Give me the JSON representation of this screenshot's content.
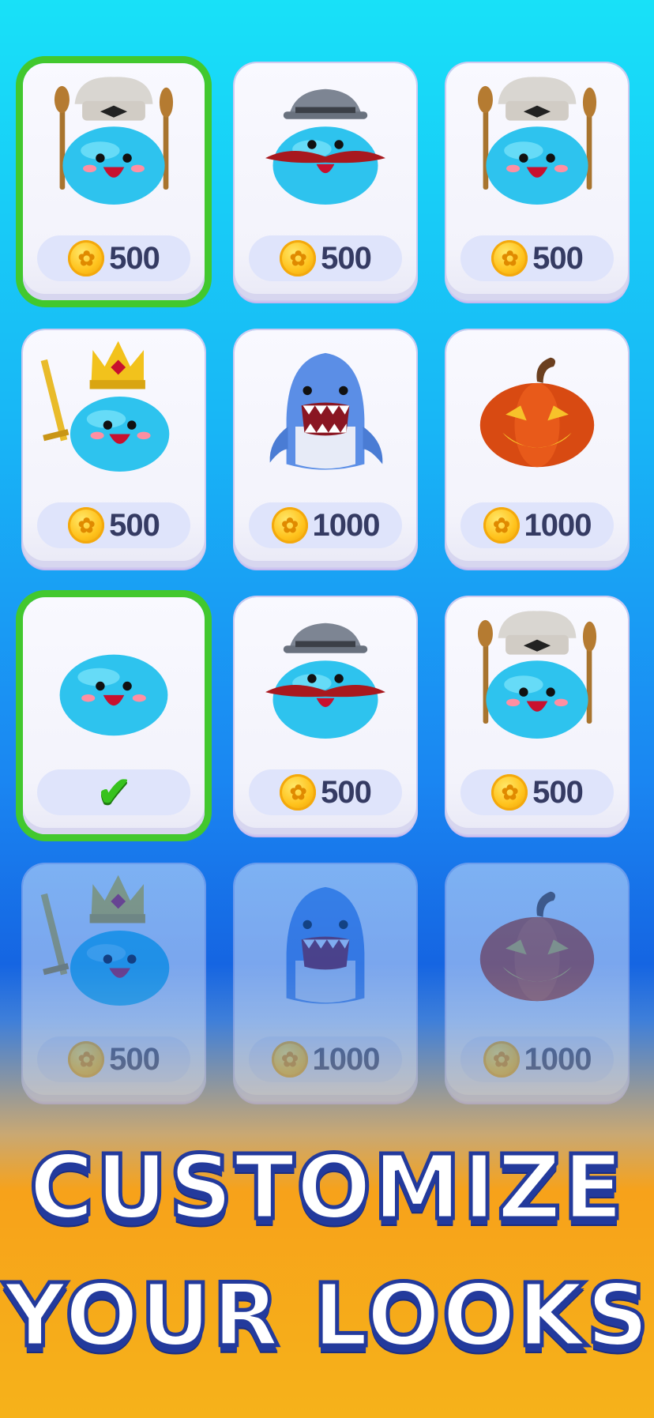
{
  "shop": {
    "items": [
      {
        "character": "chef-slime",
        "price": "500",
        "state": "selected"
      },
      {
        "character": "mustache-hat-slime",
        "price": "500",
        "state": "normal"
      },
      {
        "character": "chef-slime",
        "price": "500",
        "state": "normal"
      },
      {
        "character": "king-slime",
        "price": "500",
        "state": "normal"
      },
      {
        "character": "shark",
        "price": "1000",
        "state": "normal"
      },
      {
        "character": "pumpkin",
        "price": "1000",
        "state": "normal"
      },
      {
        "character": "plain-slime",
        "price": "",
        "state": "owned-selected"
      },
      {
        "character": "mustache-hat-slime",
        "price": "500",
        "state": "normal"
      },
      {
        "character": "chef-slime",
        "price": "500",
        "state": "normal"
      },
      {
        "character": "king-slime",
        "price": "500",
        "state": "faded"
      },
      {
        "character": "shark",
        "price": "1000",
        "state": "faded"
      },
      {
        "character": "pumpkin",
        "price": "1000",
        "state": "faded"
      }
    ]
  },
  "icons": {
    "coin": "coin-icon",
    "check": "checkmark-icon"
  },
  "colors": {
    "selected_border": "#42c82e",
    "price_text": "#353b63",
    "headline_outline": "#233a9c"
  },
  "headline": {
    "line1": "CUSTOMIZE",
    "line2": "YOUR LOOKS"
  }
}
